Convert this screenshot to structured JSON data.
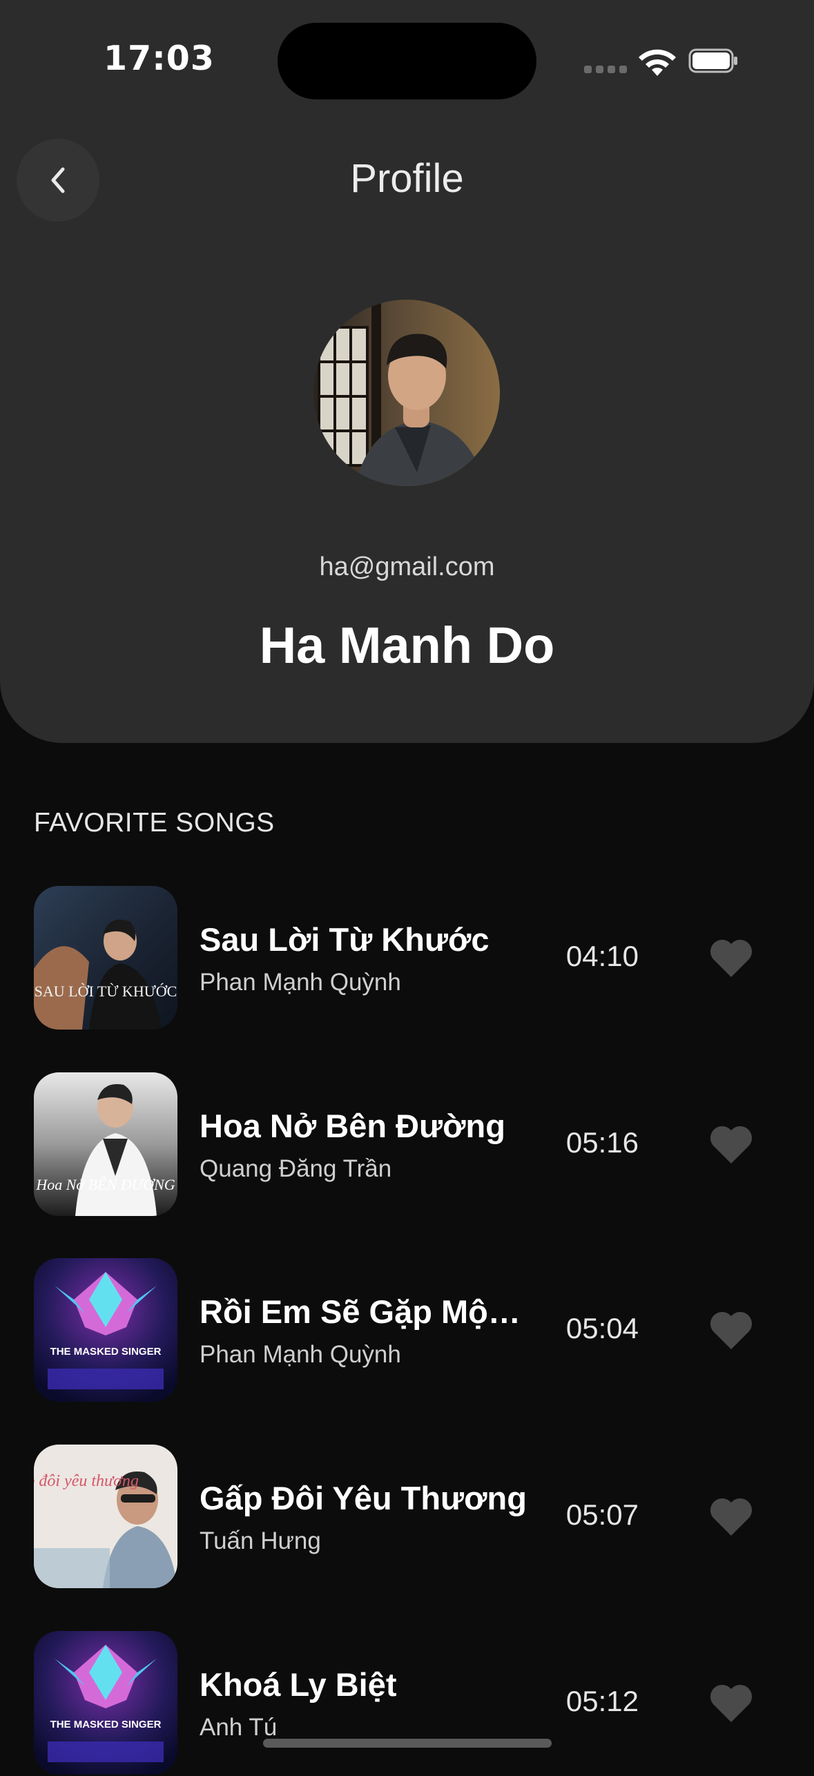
{
  "status_bar": {
    "time": "17:03"
  },
  "header": {
    "title": "Profile",
    "back_icon": "chevron-left-icon"
  },
  "profile": {
    "email": "ha@gmail.com",
    "name": "Ha Manh Do"
  },
  "favorites": {
    "section_title": "FAVORITE SONGS",
    "songs": [
      {
        "title": "Sau Lời Từ Khước",
        "artist": "Phan Mạnh Quỳnh",
        "duration": "04:10",
        "art_text": "SAU LỜI TỪ KHƯỚC"
      },
      {
        "title": "Hoa Nở Bên Đường",
        "artist": "Quang Đăng Trần",
        "duration": "05:16",
        "art_text": "Hoa Nở BÊN ĐƯỜNG"
      },
      {
        "title": "Rồi Em Sẽ Gặp Một ...",
        "artist": "Phan Mạnh Quỳnh",
        "duration": "05:04",
        "art_text": "THE MASKED SINGER"
      },
      {
        "title": "Gấp Đôi Yêu Thương",
        "artist": "Tuấn Hưng",
        "duration": "05:07",
        "art_text": "Gấp đôi yêu thương"
      },
      {
        "title": "Khoá Ly Biệt",
        "artist": "Anh Tú",
        "duration": "05:12",
        "art_text": "THE MASKED SINGER"
      }
    ]
  },
  "colors": {
    "background": "#0c0c0c",
    "card": "#2c2c2c",
    "heart": "#4a4a4a"
  }
}
